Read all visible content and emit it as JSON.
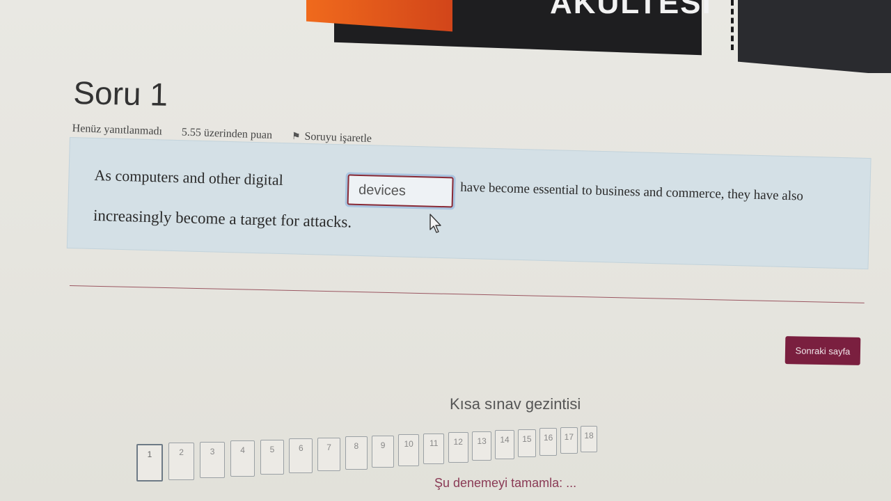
{
  "banner": {
    "text": "AKULTESI"
  },
  "question": {
    "title": "Soru 1",
    "status": "Henüz yanıtlanmadı",
    "points": "5.55 üzerinden puan",
    "flag_label": "Soruyu işaretle",
    "text_before": "As computers and other digital",
    "answer_value": "devices",
    "text_after": "have become essential to business and commerce, they have also",
    "text_line2": "increasingly become a target for attacks."
  },
  "next_button": {
    "label": "Sonraki sayfa"
  },
  "quiz_nav": {
    "title": "Kısa sınav gezintisi",
    "buttons": [
      "1",
      "2",
      "3",
      "4",
      "5",
      "6",
      "7",
      "8",
      "9",
      "10",
      "11",
      "12",
      "13",
      "14",
      "15",
      "16",
      "17",
      "18"
    ],
    "current": "1",
    "finish_label": "Şu denemeyi tamamla: ..."
  },
  "colors": {
    "accent": "#7a1f3f",
    "question_bg": "#d4e0e6",
    "input_border": "#8a2a35"
  },
  "icons": {
    "flag": "flag-icon",
    "cursor": "mouse-pointer-icon"
  }
}
